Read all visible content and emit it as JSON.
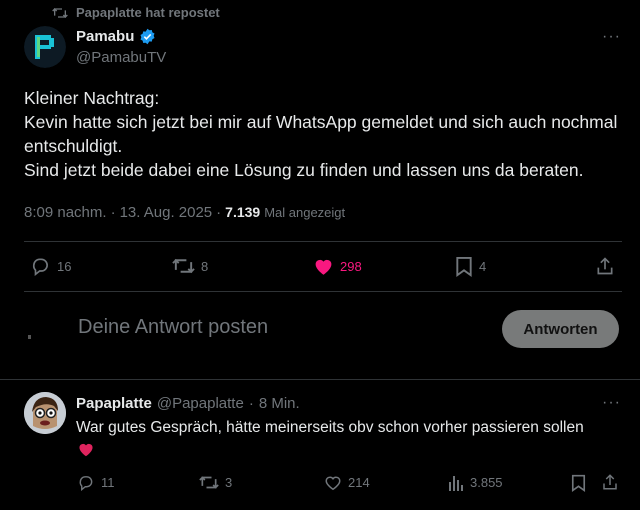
{
  "repost": {
    "label": "Papaplatte hat repostet"
  },
  "tweet": {
    "author_name": "Pamabu",
    "author_handle": "@PamabuTV",
    "text": "Kleiner Nachtrag:\nKevin hatte sich jetzt bei mir auf WhatsApp gemeldet und sich auch nochmal entschuldigt.\nSind jetzt beide dabei eine Lösung zu finden und lassen uns da beraten.",
    "time": "8:09 nachm.",
    "date": "13. Aug. 2025",
    "views": "7.139",
    "views_label": "Mal angezeigt",
    "stats": {
      "replies": "16",
      "reposts": "8",
      "likes": "298",
      "bookmarks": "4"
    }
  },
  "composer": {
    "placeholder": "Deine Antwort posten",
    "button_label": "Antworten"
  },
  "reply": {
    "author_name": "Papaplatte",
    "author_handle": "@Papaplatte",
    "age": "8 Min.",
    "text": "War gutes Gespräch, hätte meinerseits obv schon vorher passieren sollen",
    "stats": {
      "replies": "11",
      "reposts": "3",
      "likes": "214",
      "views": "3.855"
    }
  },
  "colors": {
    "like_active": "#f91880",
    "verified": "#1d9bf0",
    "heart_emoji": "#e0245e",
    "button_bg": "#787a7a"
  }
}
